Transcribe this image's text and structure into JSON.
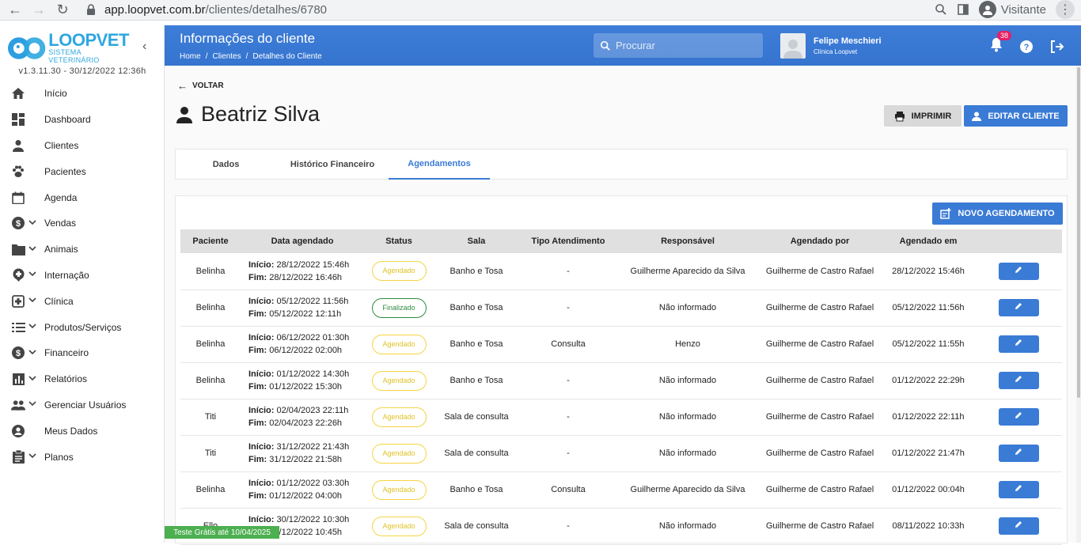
{
  "browser": {
    "url_host": "app.loopvet.com.br",
    "url_path": "/clientes/detalhes/6780",
    "profile_label": "Visitante"
  },
  "sidebar": {
    "brand": "LOOPVET",
    "brand_sub": "SISTEMA VETERINÁRIO",
    "version": "v1.3.11.30 - 30/12/2022 12:36h",
    "items": [
      {
        "label": "Início",
        "icon": "home-icon",
        "has_chevron": false
      },
      {
        "label": "Dashboard",
        "icon": "dashboard-icon",
        "has_chevron": false
      },
      {
        "label": "Clientes",
        "icon": "person-icon",
        "has_chevron": false
      },
      {
        "label": "Pacientes",
        "icon": "paw-icon",
        "has_chevron": false
      },
      {
        "label": "Agenda",
        "icon": "calendar-icon",
        "has_chevron": false
      },
      {
        "label": "Vendas",
        "icon": "dollar-icon",
        "has_chevron": true
      },
      {
        "label": "Animais",
        "icon": "folder-icon",
        "has_chevron": true
      },
      {
        "label": "Internação",
        "icon": "hospital-icon",
        "has_chevron": true
      },
      {
        "label": "Clínica",
        "icon": "clinic-icon",
        "has_chevron": true
      },
      {
        "label": "Produtos/Serviços",
        "icon": "list-icon",
        "has_chevron": true
      },
      {
        "label": "Financeiro",
        "icon": "dollar-icon",
        "has_chevron": true
      },
      {
        "label": "Relatórios",
        "icon": "chart-icon",
        "has_chevron": true
      },
      {
        "label": "Gerenciar Usuários",
        "icon": "people-icon",
        "has_chevron": true
      },
      {
        "label": "Meus Dados",
        "icon": "account-icon",
        "has_chevron": false
      },
      {
        "label": "Planos",
        "icon": "clipboard-icon",
        "has_chevron": true
      }
    ],
    "trial_label": "Teste Grátis até 10/04/2025"
  },
  "header": {
    "title": "Informações do cliente",
    "breadcrumbs": [
      "Home",
      "/",
      "Clientes",
      "/",
      "Detalhes do Cliente"
    ],
    "search_placeholder": "Procurar",
    "user_name": "Felipe Meschieri",
    "user_clinic": "Clínica Loopvet",
    "notifications_count": "38"
  },
  "main": {
    "back_label": "VOLTAR",
    "client_name": "Beatriz Silva",
    "print_label": "IMPRIMIR",
    "edit_client_label": "EDITAR CLIENTE",
    "tabs": [
      {
        "label": "Dados",
        "active": false
      },
      {
        "label": "Histórico Financeiro",
        "active": false
      },
      {
        "label": "Agendamentos",
        "active": true
      }
    ],
    "new_appointment_label": "NOVO AGENDAMENTO",
    "columns": [
      "Paciente",
      "Data agendado",
      "Status",
      "Sala",
      "Tipo Atendimento",
      "Responsável",
      "Agendado por",
      "Agendado em",
      ""
    ],
    "start_label": "Início:",
    "end_label": "Fim:",
    "rows": [
      {
        "patient": "Belinha",
        "start": "28/12/2022 15:46h",
        "end": "28/12/2022 16:46h",
        "status": "Agendado",
        "room": "Banho e Tosa",
        "type": "-",
        "responsible": "Guilherme Aparecido da Silva",
        "by": "Guilherme de Castro Rafael",
        "at": "28/12/2022 15:46h"
      },
      {
        "patient": "Belinha",
        "start": "05/12/2022 11:56h",
        "end": "05/12/2022 12:11h",
        "status": "Finalizado",
        "room": "Banho e Tosa",
        "type": "-",
        "responsible": "Não informado",
        "by": "Guilherme de Castro Rafael",
        "at": "05/12/2022 11:56h"
      },
      {
        "patient": "Belinha",
        "start": "06/12/2022 01:30h",
        "end": "06/12/2022 02:00h",
        "status": "Agendado",
        "room": "Banho e Tosa",
        "type": "Consulta",
        "responsible": "Henzo",
        "by": "Guilherme de Castro Rafael",
        "at": "05/12/2022 11:55h"
      },
      {
        "patient": "Belinha",
        "start": "01/12/2022 14:30h",
        "end": "01/12/2022 15:30h",
        "status": "Agendado",
        "room": "Banho e Tosa",
        "type": "-",
        "responsible": "Não informado",
        "by": "Guilherme de Castro Rafael",
        "at": "01/12/2022 22:29h"
      },
      {
        "patient": "Titi",
        "start": "02/04/2023 22:11h",
        "end": "02/04/2023 22:26h",
        "status": "Agendado",
        "room": "Sala de consulta",
        "type": "-",
        "responsible": "Não informado",
        "by": "Guilherme de Castro Rafael",
        "at": "01/12/2022 22:11h"
      },
      {
        "patient": "Titi",
        "start": "31/12/2022 21:43h",
        "end": "31/12/2022 21:58h",
        "status": "Agendado",
        "room": "Sala de consulta",
        "type": "-",
        "responsible": "Não informado",
        "by": "Guilherme de Castro Rafael",
        "at": "01/12/2022 21:47h"
      },
      {
        "patient": "Belinha",
        "start": "01/12/2022 03:30h",
        "end": "01/12/2022 04:00h",
        "status": "Agendado",
        "room": "Banho e Tosa",
        "type": "Consulta",
        "responsible": "Guilherme Aparecido da Silva",
        "by": "Guilherme de Castro Rafael",
        "at": "01/12/2022 00:04h"
      },
      {
        "patient": "Ello",
        "start": "30/12/2022 10:30h",
        "end": "30/12/2022 10:45h",
        "status": "Agendado",
        "room": "Sala de consulta",
        "type": "-",
        "responsible": "Não informado",
        "by": "Guilherme de Castro Rafael",
        "at": "08/11/2022 10:33h"
      }
    ]
  },
  "colors": {
    "primary": "#3a7bd5",
    "status_scheduled": "#f5d442",
    "status_done": "#2e8b3e",
    "trial_badge": "#4caf50",
    "notification_badge": "#e91e63"
  }
}
